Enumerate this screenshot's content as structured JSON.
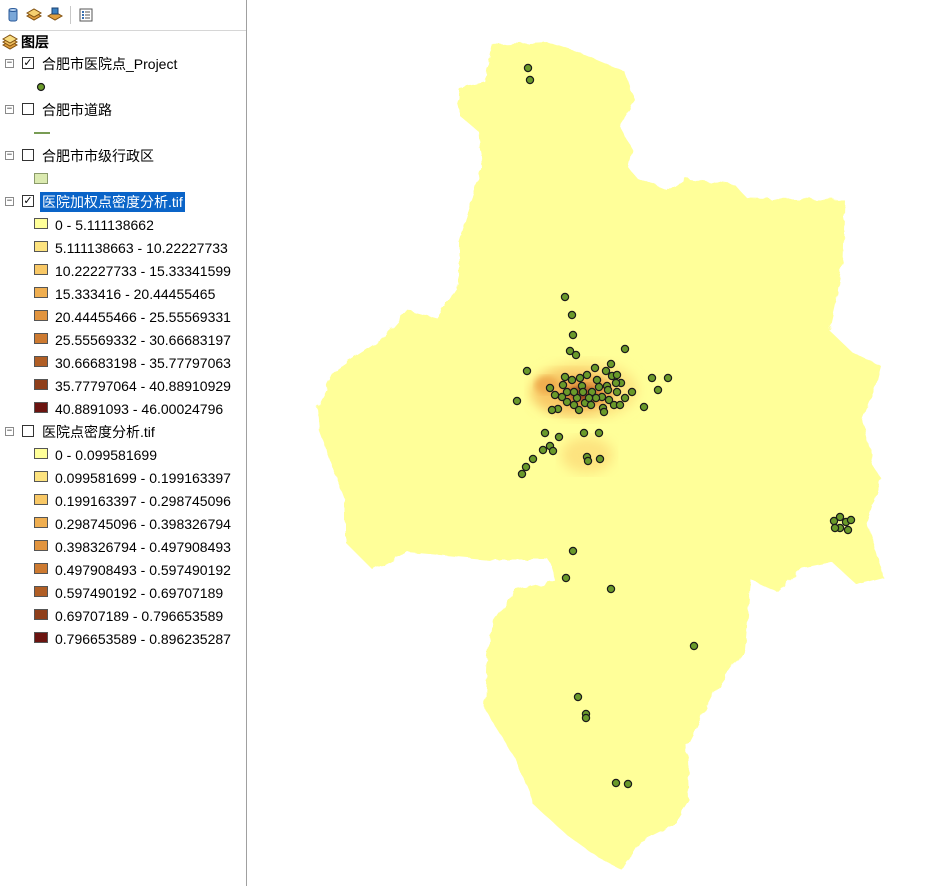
{
  "toc": {
    "toolbar": [
      "list-by-drawing-order-icon",
      "list-by-source-icon",
      "list-by-visibility-icon",
      "options-icon"
    ],
    "root_label": "图层",
    "layers": [
      {
        "label": "合肥市医院点_Project",
        "checked": true,
        "symbol": "point",
        "color": "#6a9a2a"
      },
      {
        "label": "合肥市道路",
        "checked": false,
        "symbol": "line",
        "color": "#4a7a1a"
      },
      {
        "label": "合肥市市级行政区",
        "checked": false,
        "symbol": "polygon",
        "color": "#dbeab0"
      },
      {
        "label": "医院加权点密度分析.tif",
        "checked": true,
        "selected": true,
        "symbol": "raster",
        "classes": [
          {
            "label": "0 - 5.111138662",
            "color": "#ffff99"
          },
          {
            "label": "5.111138663 - 10.22227733",
            "color": "#fde37f"
          },
          {
            "label": "10.22227733 - 15.33341599",
            "color": "#f8c866"
          },
          {
            "label": "15.333416 - 20.44455465",
            "color": "#efae50"
          },
          {
            "label": "20.44455466 - 25.55569331",
            "color": "#e1943f"
          },
          {
            "label": "25.55569332 - 30.66683197",
            "color": "#cd7a31"
          },
          {
            "label": "30.66683198 - 35.77797063",
            "color": "#b05e25"
          },
          {
            "label": "35.77797064 - 40.88910929",
            "color": "#8f3f1b"
          },
          {
            "label": "40.8891093 - 46.00024796",
            "color": "#6b1410"
          }
        ]
      },
      {
        "label": "医院点密度分析.tif",
        "checked": false,
        "symbol": "raster",
        "classes": [
          {
            "label": "0 - 0.099581699",
            "color": "#ffff99"
          },
          {
            "label": "0.099581699 - 0.199163397",
            "color": "#fde37f"
          },
          {
            "label": "0.199163397 - 0.298745096",
            "color": "#f8c866"
          },
          {
            "label": "0.298745096 - 0.398326794",
            "color": "#efae50"
          },
          {
            "label": "0.398326794 - 0.497908493",
            "color": "#e1943f"
          },
          {
            "label": "0.497908493 - 0.597490192",
            "color": "#cd7a31"
          },
          {
            "label": "0.597490192 - 0.69707189",
            "color": "#b05e25"
          },
          {
            "label": "0.69707189 - 0.796653589",
            "color": "#8f3f1b"
          },
          {
            "label": "0.796653589 - 0.896235287",
            "color": "#6b1410"
          }
        ]
      }
    ]
  },
  "map": {
    "boundary_fill": "#ffff99",
    "point_fill": "#6a9a2a",
    "hotspot_colors": [
      "#fde37f",
      "#f8c866",
      "#efae50",
      "#cd7a31",
      "#8f3f1b"
    ]
  }
}
